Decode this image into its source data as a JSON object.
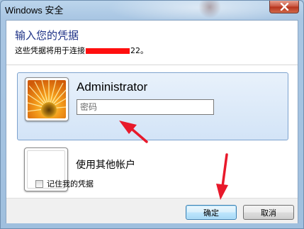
{
  "window": {
    "title": "Windows 安全"
  },
  "dialog": {
    "heading": "输入您的凭据",
    "subline_prefix": "这些凭据将用于连接",
    "subline_suffix": "22。"
  },
  "credential_tiles": [
    {
      "username": "Administrator",
      "password_placeholder": "密码",
      "password_value": ""
    },
    {
      "label": "使用其他帐户"
    }
  ],
  "remember_label": "记住我的凭据",
  "remember_checked": false,
  "buttons": {
    "ok_label": "确定",
    "cancel_label": "取消"
  },
  "icons": {
    "close": "close-icon",
    "avatar_primary": "flower-avatar-icon",
    "avatar_other": "blank-avatar-icon"
  },
  "colors": {
    "heading": "#1e3287",
    "redaction": "#ff0f0f",
    "annotation_arrow": "#e8192b",
    "close_button": "#c7503a"
  }
}
